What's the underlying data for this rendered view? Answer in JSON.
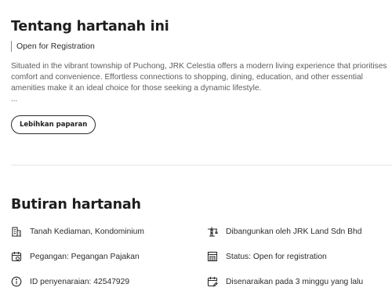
{
  "about": {
    "title": "Tentang hartanah ini",
    "status_tag": "Open for Registration",
    "description": "Situated in the vibrant township of Puchong, JRK Celestia offers a modern living experience that prioritises comfort and convenience. Effortless connections to shopping, dining, education, and other essential amenities make it an ideal choice for those seeking a dynamic lifestyle.",
    "ellipsis": "...",
    "expand_label": "Lebihkan paparan"
  },
  "details": {
    "title": "Butiran hartanah",
    "items": [
      {
        "icon": "building-icon",
        "text": "Tanah Kediaman, Kondominium"
      },
      {
        "icon": "crane-icon",
        "text": "Dibangunkan oleh JRK Land Sdn Bhd"
      },
      {
        "icon": "calendar-icon",
        "text": "Pegangan: Pegangan Pajakan"
      },
      {
        "icon": "status-icon",
        "text": "Status: Open for registration"
      },
      {
        "icon": "info-icon",
        "text": "ID penyenaraian: 42547929"
      },
      {
        "icon": "calendar-edit-icon",
        "text": "Disenaraikan pada 3 minggu yang lalu"
      }
    ]
  }
}
